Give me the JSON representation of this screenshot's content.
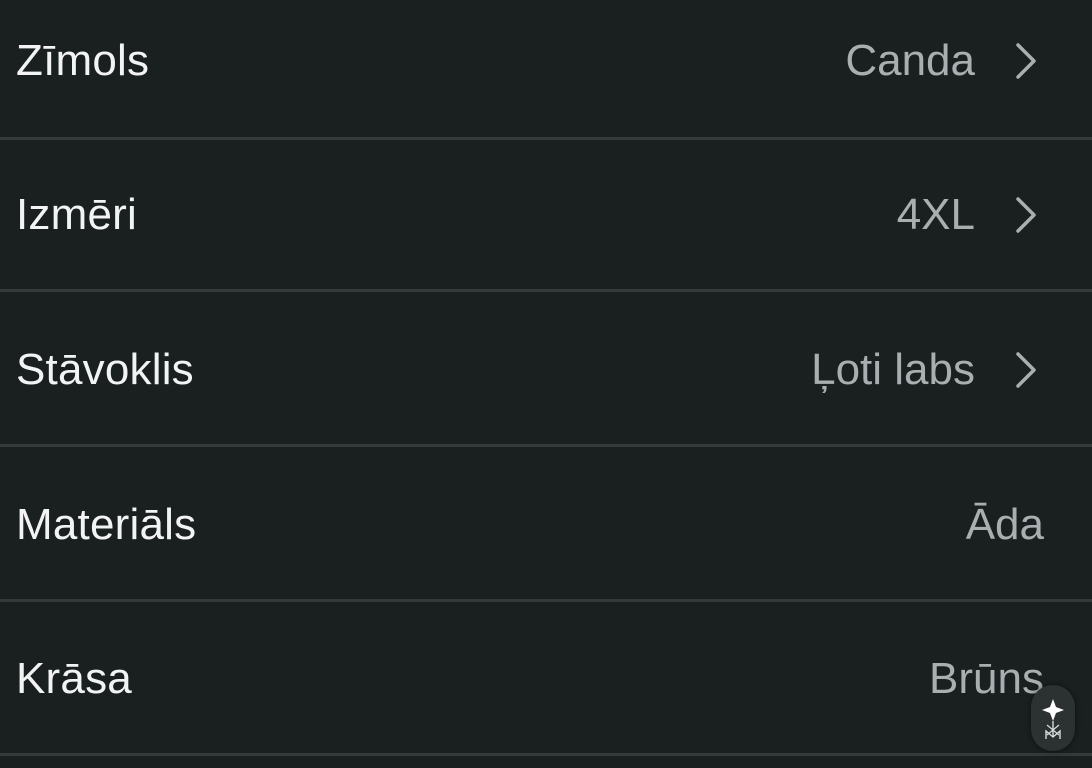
{
  "rows": [
    {
      "label": "Zīmols",
      "value": "Canda",
      "chevron": true
    },
    {
      "label": "Izmēri",
      "value": "4XL",
      "chevron": true
    },
    {
      "label": "Stāvoklis",
      "value": "Ļoti labs",
      "chevron": true
    },
    {
      "label": "Materiāls",
      "value": "Āda",
      "chevron": false
    },
    {
      "label": "Krāsa",
      "value": "Brūns",
      "chevron": false
    }
  ],
  "icons": {
    "chevron": "chevron-right-icon",
    "badge": "watermark-logo-icon"
  },
  "colors": {
    "background": "#1a1f20",
    "divider": "#343a3b",
    "label": "#f2f4f4",
    "value": "#a9afb0"
  }
}
